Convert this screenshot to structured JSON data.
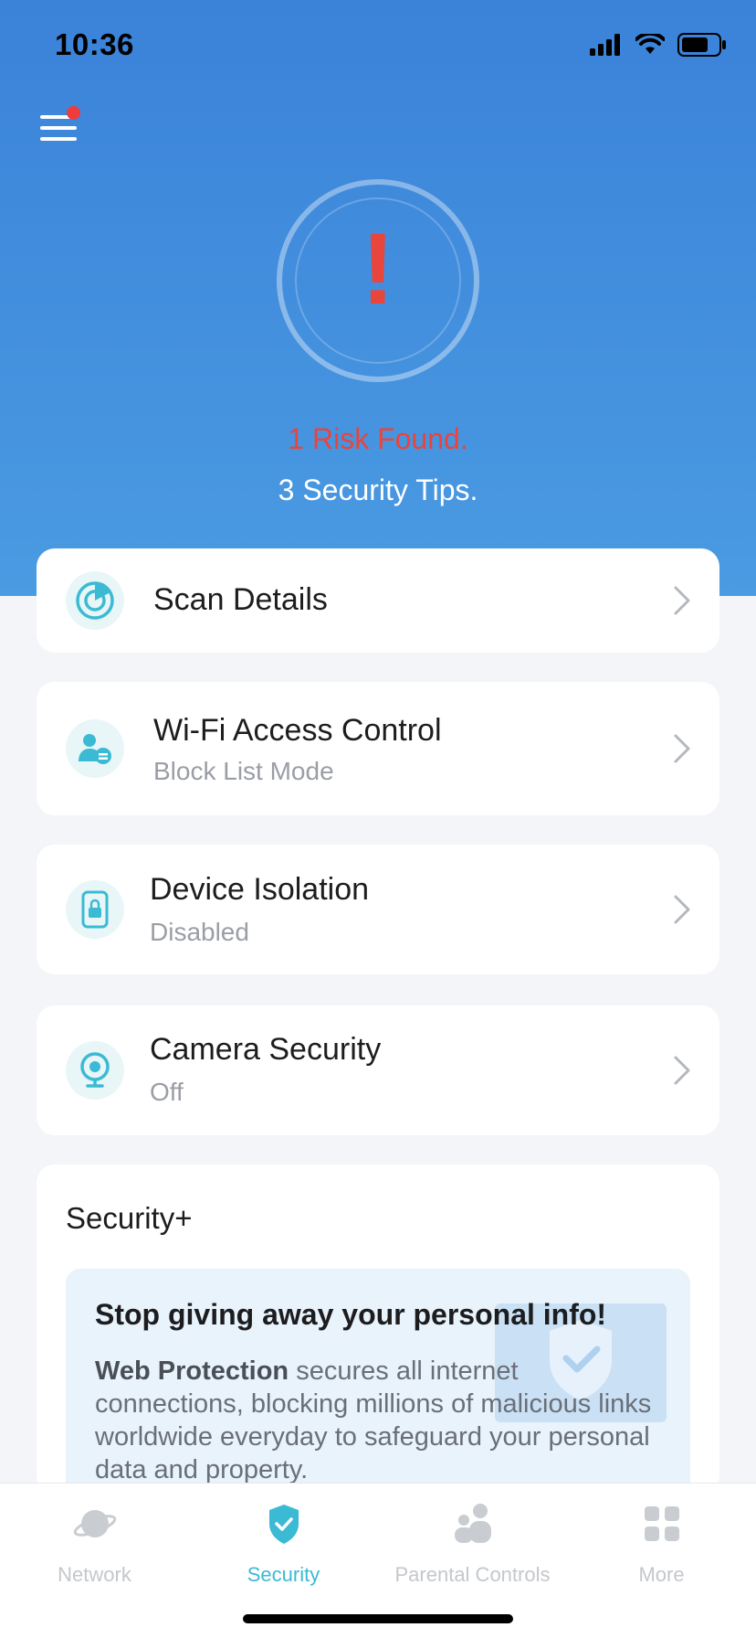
{
  "status_bar": {
    "time": "10:36"
  },
  "header": {
    "menu_icon": "hamburger-menu-icon",
    "risk_text": "1 Risk Found.",
    "tips_text": "3 Security Tips.",
    "alert_symbol": "!"
  },
  "items": [
    {
      "title": "Scan Details",
      "subtitle": "",
      "icon": "scan-icon"
    },
    {
      "title": "Wi-Fi Access Control",
      "subtitle": "Block List Mode",
      "icon": "user-access-icon"
    },
    {
      "title": "Device Isolation",
      "subtitle": "Disabled",
      "icon": "device-lock-icon"
    },
    {
      "title": "Camera Security",
      "subtitle": "Off",
      "icon": "camera-icon"
    }
  ],
  "security_plus": {
    "title": "Security+",
    "promo_title": "Stop giving away your personal info!",
    "promo_bold": "Web Protection",
    "promo_body": " secures all internet connections, blocking millions of malicious links worldwide everyday to safeguard your personal data and property."
  },
  "tabs": [
    {
      "label": "Network",
      "icon": "planet-icon",
      "active": false
    },
    {
      "label": "Security",
      "icon": "shield-check-icon",
      "active": true
    },
    {
      "label": "Parental Controls",
      "icon": "family-icon",
      "active": false
    },
    {
      "label": "More",
      "icon": "grid-icon",
      "active": false
    }
  ],
  "colors": {
    "hero_top": "#3b82d9",
    "hero_bottom": "#4a9be2",
    "risk_red": "#e8453c",
    "accent_teal": "#3bbad4",
    "page_bg": "#f3f5f8"
  }
}
